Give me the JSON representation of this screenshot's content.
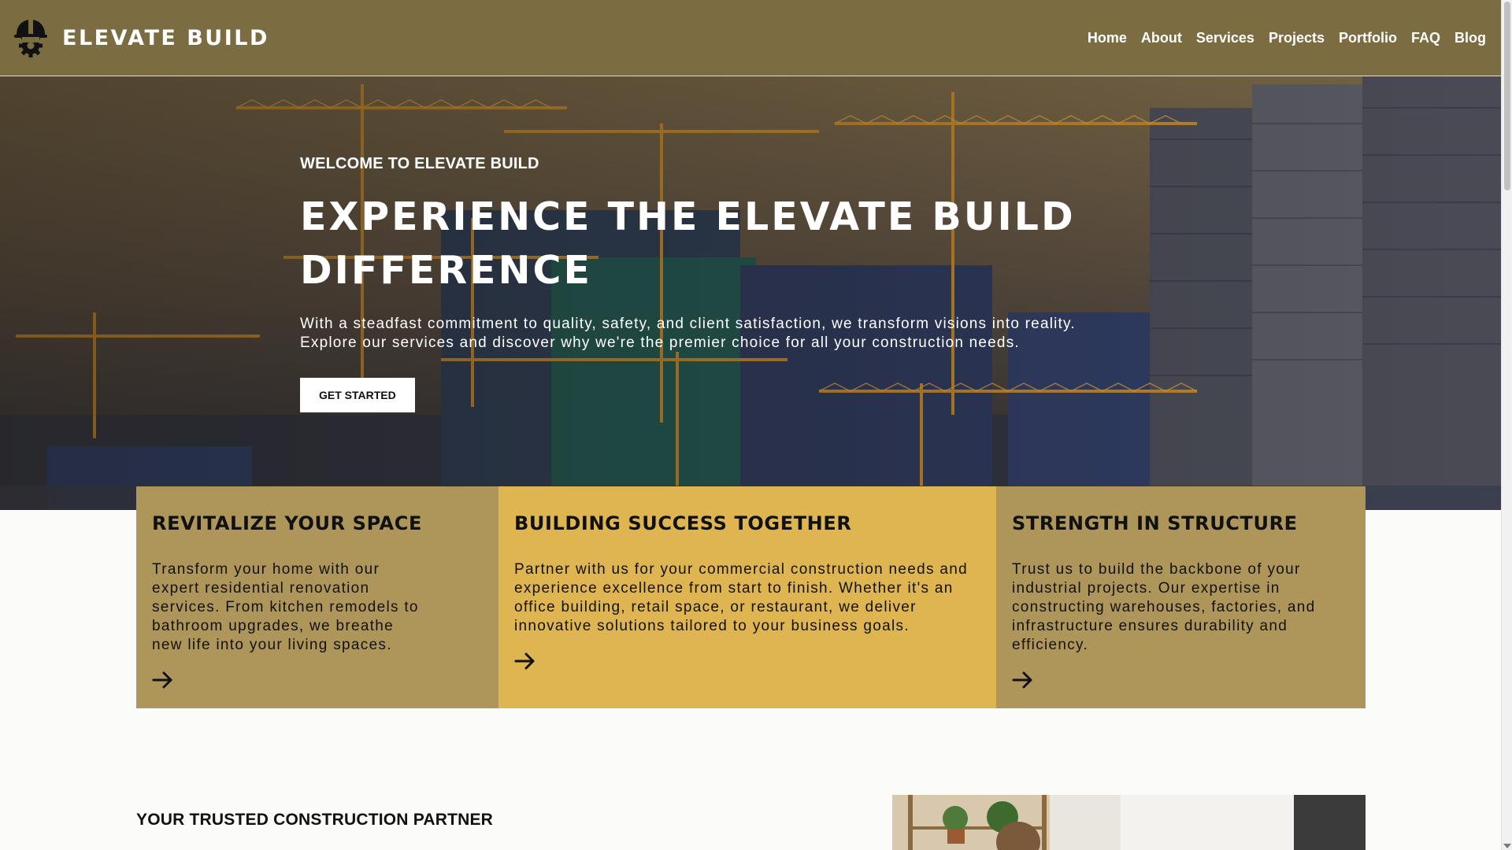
{
  "brand": {
    "name": "ELEVATE BUILD",
    "logo_icon": "hardhat-gear-icon"
  },
  "nav": {
    "items": [
      {
        "label": "Home"
      },
      {
        "label": "About"
      },
      {
        "label": "Services"
      },
      {
        "label": "Projects"
      },
      {
        "label": "Portfolio"
      },
      {
        "label": "FAQ"
      },
      {
        "label": "Blog"
      }
    ]
  },
  "hero": {
    "eyebrow": "WELCOME TO ELEVATE BUILD",
    "title": "EXPERIENCE THE ELEVATE BUILD DIFFERENCE",
    "text": "With a steadfast commitment to quality, safety, and client satisfaction, we transform visions into reality. Explore our services and discover why we're the premier choice for all your construction needs.",
    "button_label": "GET STARTED",
    "background_image": "construction-cranes-city-skyline"
  },
  "cards": [
    {
      "title": "REVITALIZE YOUR SPACE",
      "text": "Transform your home with our expert residential renovation services. From kitchen remodels to bathroom upgrades, we breathe new life into your living spaces.",
      "arrow_icon": "arrow-right-icon",
      "color": "#ae965a"
    },
    {
      "title": "BUILDING SUCCESS TOGETHER",
      "text": "Partner with us for your commercial construction needs and experience excellence from start to finish. Whether it's an office building, retail space, or restaurant, we deliver innovative solutions tailored to your business goals.",
      "arrow_icon": "arrow-right-icon",
      "color": "#deb550"
    },
    {
      "title": "STRENGTH IN STRUCTURE",
      "text": "Trust us to build the backbone of your industrial projects. Our expertise in constructing warehouses, factories, and infrastructure ensures durability and efficiency.",
      "arrow_icon": "arrow-right-icon",
      "color": "#ae965a"
    }
  ],
  "partner": {
    "heading": "YOUR TRUSTED CONSTRUCTION PARTNER",
    "image": "interior-shelves-plants-person"
  },
  "colors": {
    "header": "#7b6c42",
    "accent_gold": "#deb550",
    "accent_tan": "#ae965a",
    "page_background": "#fbfbfa"
  }
}
